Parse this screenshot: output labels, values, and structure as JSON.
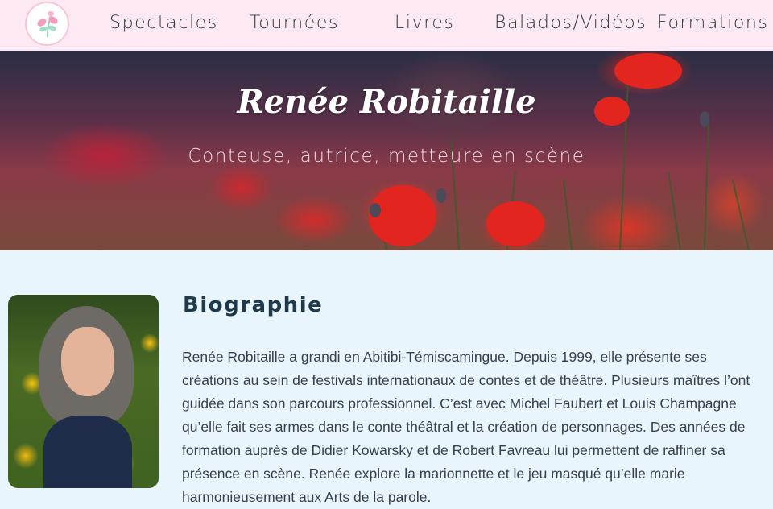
{
  "nav": {
    "logo_icon": "flower-logo-icon",
    "items": [
      {
        "label": "Spectacles"
      },
      {
        "label": "Tournées"
      },
      {
        "label": "Livres"
      },
      {
        "label": "Balados/Vidéos"
      },
      {
        "label": "Formations"
      }
    ]
  },
  "hero": {
    "title": "Renée Robitaille",
    "subtitle": "Conteuse, autrice, metteure en scène"
  },
  "bio": {
    "heading": "Biographie",
    "text": "Renée Robitaille a grandi en Abitibi-Témiscamingue. Depuis 1999, elle présente ses créations au sein de festivals internationaux de contes et de théâtre. Plusieurs maîtres l’ont guidée dans son parcours professionnel. C’est avec Michel Faubert et Louis Champagne qu’elle fait ses armes dans le conte théâtral et la création de personnages. Des années de formation auprès de Didier Kowarsky et de Robert Favreau lui permettent de raffiner sa présence en scène. Renée explore la marionnette et le jeu masqué qu’elle marie harmonieusement aux Arts de la parole."
  },
  "colors": {
    "nav_background": "#fde9f4",
    "page_background": "#e8f5fd",
    "heading": "#1e3a4a"
  }
}
